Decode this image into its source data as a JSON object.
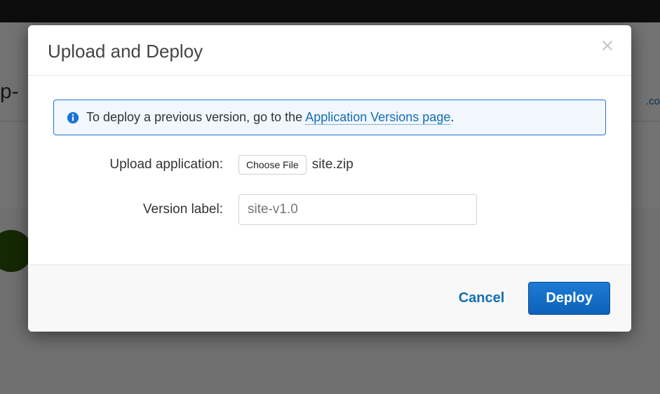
{
  "background": {
    "left_text_fragment": "p-",
    "right_text_fragment": ".co"
  },
  "modal": {
    "title": "Upload and Deploy",
    "info_alert": {
      "prefix_text": "To deploy a previous version, go to the ",
      "link_text": "Application Versions page",
      "suffix_text": "."
    },
    "upload": {
      "label": "Upload application:",
      "choose_file_button": "Choose File",
      "selected_file": "site.zip"
    },
    "version": {
      "label": "Version label:",
      "value": "site-v1.0"
    },
    "actions": {
      "cancel": "Cancel",
      "deploy": "Deploy"
    }
  }
}
